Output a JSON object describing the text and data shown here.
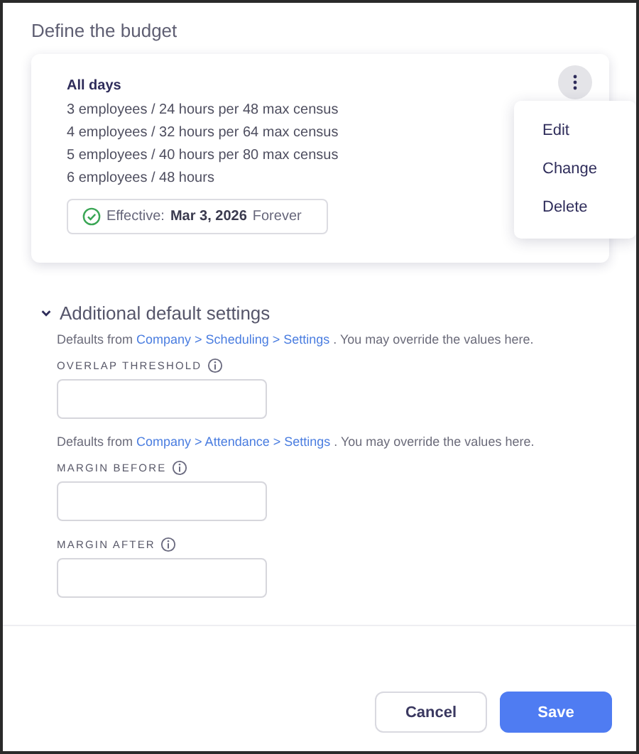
{
  "title": "Define the budget",
  "budget": {
    "heading": "All days",
    "lines": [
      "3 employees / 24 hours per 48 max census",
      "4 employees / 32 hours per 64 max census",
      "5 employees / 40 hours per 80 max census",
      "6 employees / 48 hours"
    ],
    "effective": {
      "label": "Effective:",
      "date": "Mar 3, 2026",
      "until": "Forever"
    },
    "menu_open": true,
    "menu": [
      "Edit",
      "Change",
      "Delete"
    ]
  },
  "additional": {
    "title": "Additional default settings",
    "expanded": true,
    "groups": [
      {
        "note": {
          "before": "Defaults from",
          "link": "Company > Scheduling > Settings",
          "after": ". You may override the values here."
        },
        "fields": [
          {
            "label": "OVERLAP THRESHOLD"
          }
        ]
      },
      {
        "note": {
          "before": "Defaults from",
          "link": "Company > Attendance > Settings",
          "after": ". You may override the values here."
        },
        "fields": [
          {
            "label": "MARGIN BEFORE"
          },
          {
            "label": "MARGIN AFTER"
          }
        ]
      }
    ]
  },
  "buttons": {
    "cancel": "Cancel",
    "save": "Save"
  }
}
